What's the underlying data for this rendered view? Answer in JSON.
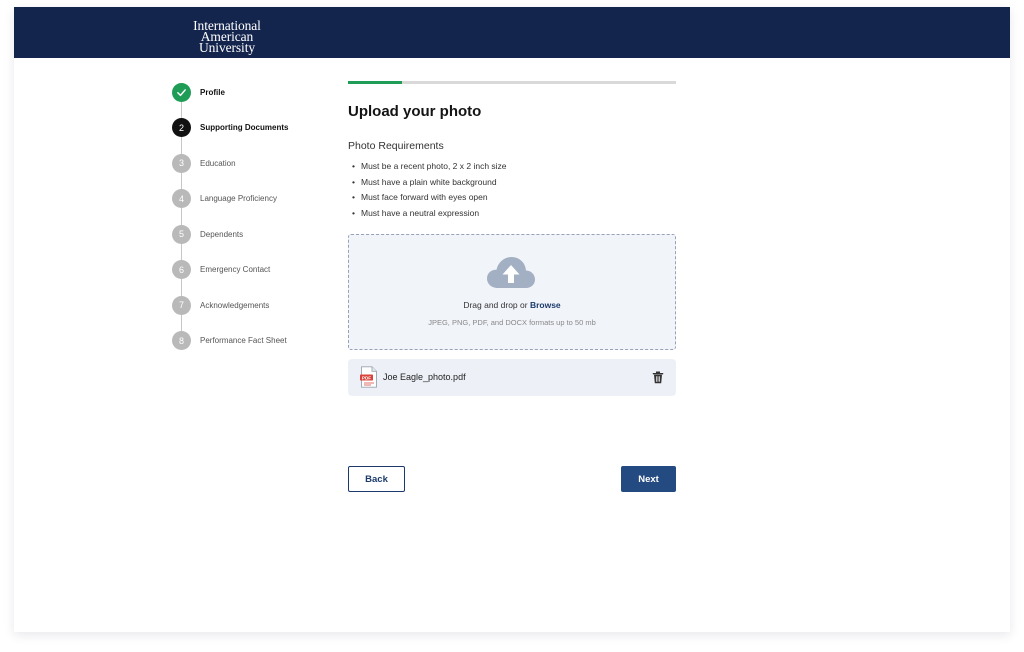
{
  "header": {
    "brand_line1": "International",
    "brand_line2": "American University",
    "background_color": "#13244d"
  },
  "steps": [
    {
      "number": "",
      "label": "Profile",
      "state": "completed",
      "icon": "checkmark-icon"
    },
    {
      "number": "2",
      "label": "Supporting Documents",
      "state": "current"
    },
    {
      "number": "3",
      "label": "Education",
      "state": "pending"
    },
    {
      "number": "4",
      "label": "Language Proficiency",
      "state": "pending"
    },
    {
      "number": "5",
      "label": "Dependents",
      "state": "pending"
    },
    {
      "number": "6",
      "label": "Emergency Contact",
      "state": "pending"
    },
    {
      "number": "7",
      "label": "Acknowledgements",
      "state": "pending"
    },
    {
      "number": "8",
      "label": "Performance Fact Sheet",
      "state": "pending"
    }
  ],
  "progress": {
    "fraction": 0.165,
    "color": "#1f9d57"
  },
  "main": {
    "title": "Upload your photo",
    "requirements_title": "Photo Requirements",
    "requirements": [
      "Must be a recent photo, 2 x 2 inch size",
      "Must have a plain white background",
      "Must face forward with eyes open",
      "Must have a neutral expression"
    ]
  },
  "upload": {
    "icon": "cloud-upload-icon",
    "prompt": "Drag and drop or",
    "browse": "Browse",
    "formats": "JPEG, PNG, PDF, and DOCX formats up to 50 mb"
  },
  "file": {
    "icon": "pdf-file-icon",
    "icon_text": "PDF",
    "name": "Joe Eagle_photo.pdf",
    "delete_icon": "trash-icon"
  },
  "buttons": {
    "back": "Back",
    "next": "Next"
  },
  "colors": {
    "accent": "#244a82",
    "success": "#1f9d57",
    "dropzone_bg": "#f1f4f9"
  }
}
